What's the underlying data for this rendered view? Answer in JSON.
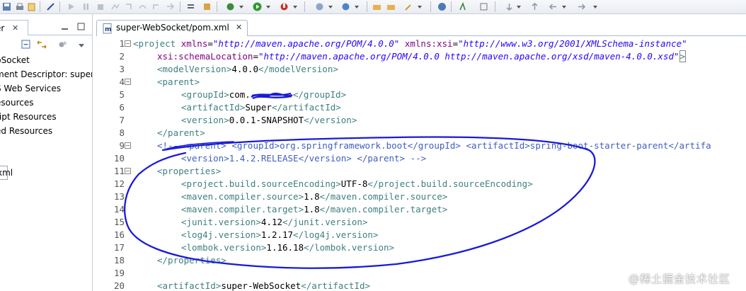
{
  "editor": {
    "tab_title": "super-WebSocket/pom.xml",
    "line_numbers": [
      "1",
      "2",
      "3",
      "4",
      "5",
      "6",
      "7",
      "8",
      "9",
      "10",
      "11",
      "12",
      "13",
      "14",
      "15",
      "16",
      "17",
      "18",
      "19",
      "20"
    ]
  },
  "left_panel": {
    "tab_label": "er",
    "tree_items": [
      "bSocket",
      "ment Descriptor: super",
      "S Web Services",
      "esources",
      "ript Resources",
      "ed Resources"
    ],
    "selected_item_label": "xml"
  },
  "code": {
    "l1_a": "<project ",
    "l1_b": "xmlns",
    "l1_c": "=",
    "l1_d": "\"http://maven.apache.org/POM/4.0.0\"",
    "l1_e": " xmlns:xsi",
    "l1_f": "=",
    "l1_g": "\"http://www.w3.org/2001/XMLSchema-instance\"",
    "l2_a": "xsi:schemaLocation",
    "l2_b": "=",
    "l2_c": "\"http://maven.apache.org/POM/4.0.0 http://maven.apache.org/xsd/maven-4.0.0.xsd\"",
    "l2_d": ">",
    "l3_a": "<modelVersion>",
    "l3_b": "4.0.0",
    "l3_c": "</modelVersion>",
    "l4_a": "<parent>",
    "l5_a": "<groupId>",
    "l5_b": "com.",
    "l5_c": "</groupId>",
    "l6_a": "<artifactId>",
    "l6_b": "Super",
    "l6_c": "</artifactId>",
    "l7_a": "<version>",
    "l7_b": "0.0.1-SNAPSHOT",
    "l7_c": "</version>",
    "l8_a": "</parent>",
    "l9_a": "<!-- <parent> <groupId>org.springframework.boot</groupId> <artifactId>spring-boot-starter-parent</artifa",
    "l10_a": "<version>1.4.2.RELEASE</version> </parent> -->",
    "l11_a": "<properties>",
    "l12_a": "<project.build.sourceEncoding>",
    "l12_b": "UTF-8",
    "l12_c": "</project.build.sourceEncoding>",
    "l13_a": "<maven.compiler.source>",
    "l13_b": "1.8",
    "l13_c": "</maven.compiler.source>",
    "l14_a": "<maven.compiler.target>",
    "l14_b": "1.8",
    "l14_c": "</maven.compiler.target>",
    "l15_a": "<junit.version>",
    "l15_b": "4.12",
    "l15_c": "</junit.version>",
    "l16_a": "<log4j.version>",
    "l16_b": "1.2.17",
    "l16_c": "</log4j.version>",
    "l17_a": "<lombok.version>",
    "l17_b": "1.16.18",
    "l17_c": "</lombok.version>",
    "l18_a": "</properties>",
    "l20_a": "<artifactId>",
    "l20_b": "super-WebSocket",
    "l20_c": "</artifactId>"
  },
  "watermark": "@稀土掘金技术社区",
  "colors": {
    "xml_tag": "#3f7f7f",
    "xml_attribute": "#7f007f",
    "xml_string": "#2a00ff",
    "xml_comment": "#3f5fbf",
    "annotation_ink": "#1a1ad8"
  }
}
